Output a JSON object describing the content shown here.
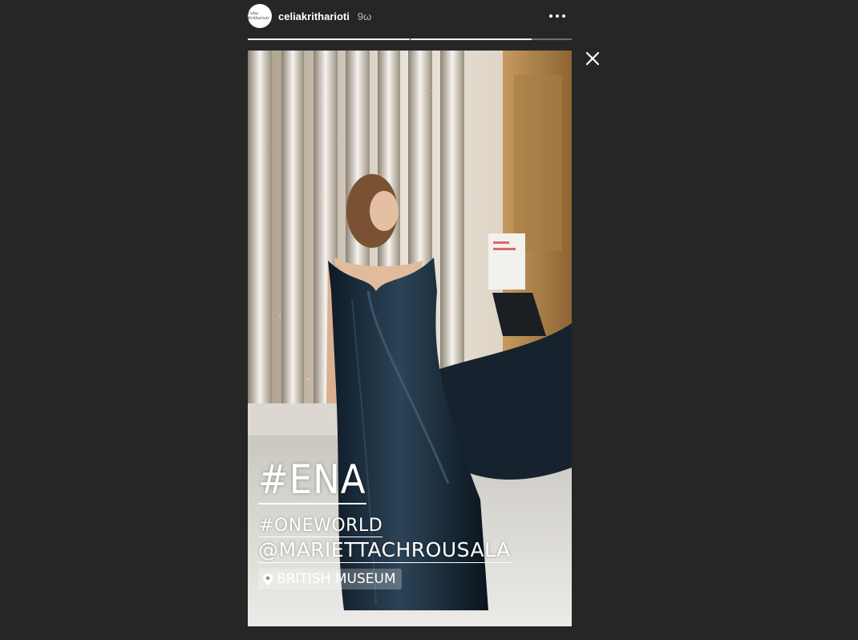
{
  "header": {
    "avatar_text": "Celia Kritharioti",
    "username": "celiakritharioti",
    "time_ago": "9ω",
    "more_icon": "more-options-icon"
  },
  "progress": {
    "segments": 2,
    "current_fraction": 0.75
  },
  "close_icon": "close-icon",
  "story": {
    "hashtag_main": "#ENA",
    "hashtag_secondary": "#ONEWORLD",
    "mention": "@MARIETTACHROUSALA",
    "location": "BRITISH MUSEUM",
    "location_icon": "location-pin-icon"
  }
}
